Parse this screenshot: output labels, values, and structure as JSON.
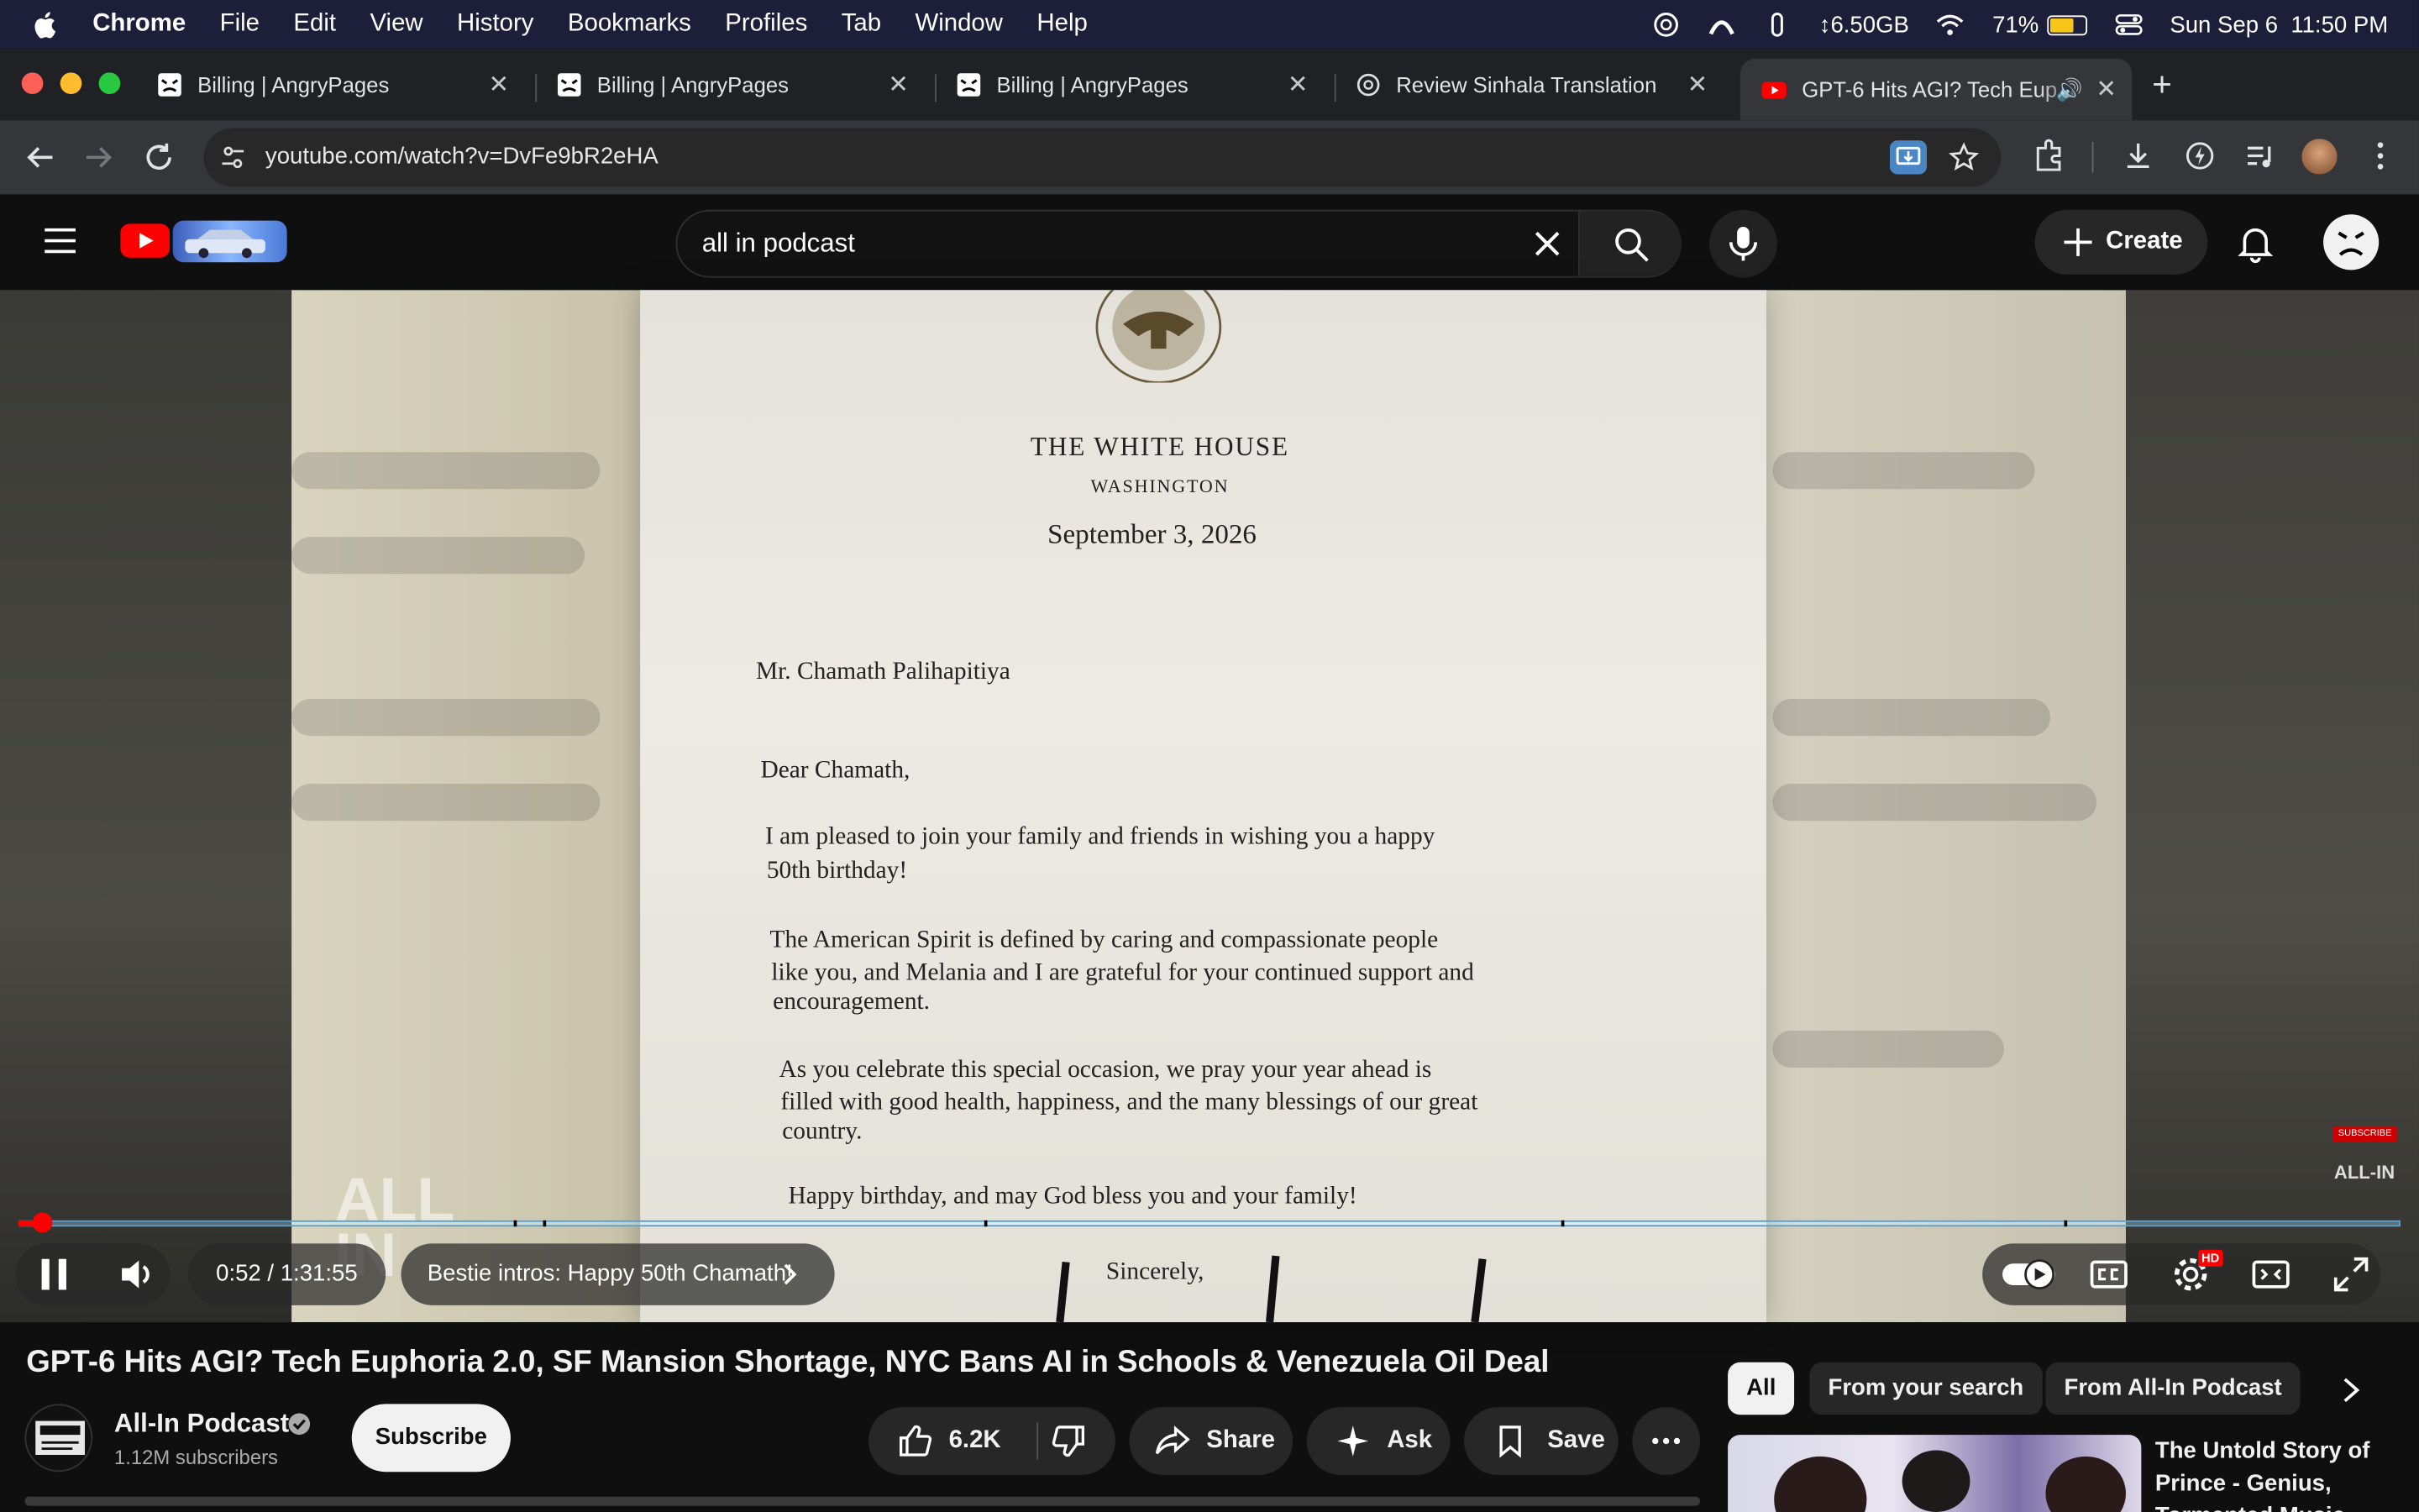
{
  "menubar": {
    "app": "Chrome",
    "items": [
      "File",
      "Edit",
      "View",
      "History",
      "Bookmarks",
      "Profiles",
      "Tab",
      "Window",
      "Help"
    ],
    "memory": "6.50GB",
    "battery_percent": "71%",
    "battery_level": 0.71,
    "datetime": "Sun Sep 6  11:50 PM"
  },
  "tabs": [
    {
      "title": "Billing | AngryPages",
      "active": false
    },
    {
      "title": "Billing | AngryPages",
      "active": false
    },
    {
      "title": "Billing | AngryPages",
      "active": false
    },
    {
      "title": "Review Sinhala Translation",
      "active": false
    },
    {
      "title": "GPT-6 Hits AGI? Tech Eup",
      "active": true
    }
  ],
  "omnibox": {
    "url": "youtube.com/watch?v=DvFe9bR2eHA"
  },
  "youtube": {
    "search_value": "all in podcast",
    "create_label": "Create"
  },
  "letter": {
    "title": "THE WHITE HOUSE",
    "subtitle": "WASHINGTON",
    "date": "September 3, 2026",
    "addressee": "Mr. Chamath Palihapitiya",
    "salutation": "Dear Chamath,",
    "p1_line1": "I am pleased to join your family and friends in wishing you a happy",
    "p1_line2": "50th birthday!",
    "p2_line1": "The American Spirit is defined by caring and compassionate people",
    "p2_line2": "like you, and Melania and I are grateful for your continued support and",
    "p2_line3": "encouragement.",
    "p3_line1": "As you celebrate this special occasion, we pray your year ahead is",
    "p3_line2": "filled with good health, happiness, and the many blessings of our great",
    "p3_line3": "country.",
    "closing_line": "Happy birthday, and may God bless you and your family!",
    "signoff": "Sincerely,"
  },
  "player": {
    "time": "0:52 / 1:31:55",
    "progress_fraction": 0.0094,
    "chapter": "Bestie intros: Happy 50th Chamath!",
    "watermark_subscribe": "SUBSCRIBE",
    "watermark_channel": "ALL-IN",
    "watermark_logo_line1": "ALL",
    "watermark_logo_line2": "IN",
    "hd_badge": "HD"
  },
  "video": {
    "title": "GPT-6 Hits AGI? Tech Euphoria 2.0, SF Mansion Shortage, NYC Bans AI in Schools & Venezuela Oil Deal",
    "channel": "All-In Podcast",
    "subscribers": "1.12M subscribers",
    "subscribe_label": "Subscribe",
    "likes": "6.2K",
    "share_label": "Share",
    "ask_label": "Ask",
    "save_label": "Save"
  },
  "sidebar": {
    "chips": [
      "All",
      "From your search",
      "From All-In Podcast"
    ],
    "rec_title": "The Untold Story of Prince - Genius, Tormented Music..."
  },
  "colors": {
    "accent_red": "#ff0000",
    "progress_border": "#4aa3df"
  }
}
